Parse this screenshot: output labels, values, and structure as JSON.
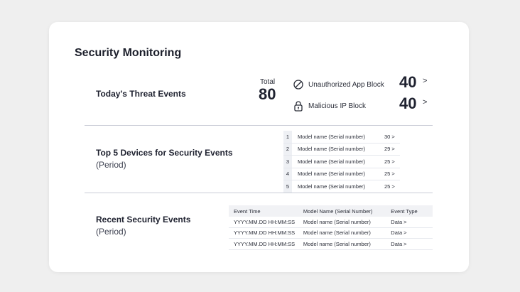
{
  "page": {
    "title": "Security Monitoring"
  },
  "threats": {
    "title": "Today's Threat Events",
    "total_label": "Total",
    "total_value": "80",
    "items": [
      {
        "icon": "block-icon",
        "label": "Unauthorized App Block",
        "value": "40"
      },
      {
        "icon": "lock-icon",
        "label": "Malicious IP Block",
        "value": "40"
      }
    ]
  },
  "top5": {
    "title": "Top 5 Devices for Security Events",
    "subtitle": "(Period)",
    "rows": [
      {
        "rank": "1",
        "model": "Model name (Serial number)",
        "count": "30"
      },
      {
        "rank": "2",
        "model": "Model name (Serial number)",
        "count": "29"
      },
      {
        "rank": "3",
        "model": "Model name (Serial number)",
        "count": "25"
      },
      {
        "rank": "4",
        "model": "Model name (Serial number)",
        "count": "25"
      },
      {
        "rank": "5",
        "model": "Model name (Serial number)",
        "count": "25"
      }
    ]
  },
  "recent": {
    "title": "Recent Security Events",
    "subtitle": "(Period)",
    "headers": [
      "Event Time",
      "Model Name (Serial Number)",
      "Event Type"
    ],
    "rows": [
      {
        "time": "YYYY.MM.DD HH:MM:SS",
        "model": "Model name (Serial number)",
        "type": "Data"
      },
      {
        "time": "YYYY.MM.DD HH:MM:SS",
        "model": "Model name (Serial number)",
        "type": "Data"
      },
      {
        "time": "YYYY.MM.DD HH:MM:SS",
        "model": "Model name (Serial number)",
        "type": "Data"
      }
    ]
  },
  "chevron": ">"
}
